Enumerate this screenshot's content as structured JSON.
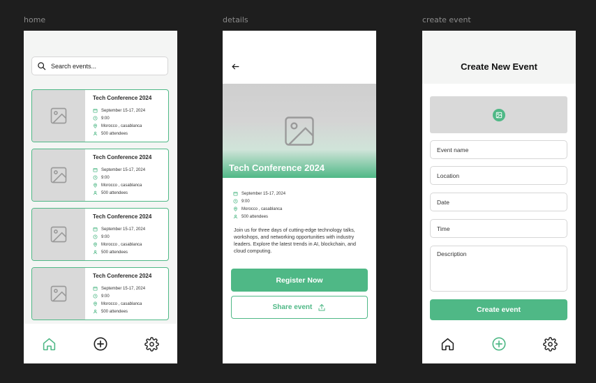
{
  "frames": {
    "home": "home",
    "details": "details",
    "create": "create event"
  },
  "home": {
    "search_placeholder": "Search events...",
    "events": [
      {
        "title": "Tech Conference 2024",
        "date": "September 15-17, 2024",
        "time": "9:00",
        "location": "Morocco , casablanca",
        "attendees": "500 attendees"
      },
      {
        "title": "Tech Conference 2024",
        "date": "September 15-17, 2024",
        "time": "9:00",
        "location": "Morocco , casablanca",
        "attendees": "500 attendees"
      },
      {
        "title": "Tech Conference 2024",
        "date": "September 15-17, 2024",
        "time": "9:00",
        "location": "Morocco , casablanca",
        "attendees": "500 attendees"
      },
      {
        "title": "Tech Conference 2024",
        "date": "September 15-17, 2024",
        "time": "9:00",
        "location": "Morocco , casablanca",
        "attendees": "500 attendees"
      }
    ],
    "nav": [
      "home-icon",
      "add-circle-icon",
      "gear-icon"
    ],
    "nav_active": "home"
  },
  "details": {
    "title": "Tech Conference 2024",
    "date": "September 15-17, 2024",
    "time": "9:00",
    "location": "Morocco , casablanca",
    "attendees": "500 attendees",
    "description": "Join us for three days of cutting-edge technology talks, workshops, and networking opportunities with industry leaders. Explore the latest trends in AI, blockchain, and cloud computing.",
    "register_label": "Register Now",
    "share_label": "Share event"
  },
  "create": {
    "title": "Create New Event",
    "event_name_placeholder": "Event name",
    "location_placeholder": "Location",
    "date_placeholder": "Date",
    "time_placeholder": "Time",
    "description_placeholder": "Description",
    "submit_label": "Create event",
    "nav_active": "add"
  },
  "colors": {
    "accent": "#4fb886",
    "placeholder_gray": "#d9d9d9",
    "canvas": "#1e1e1e"
  }
}
